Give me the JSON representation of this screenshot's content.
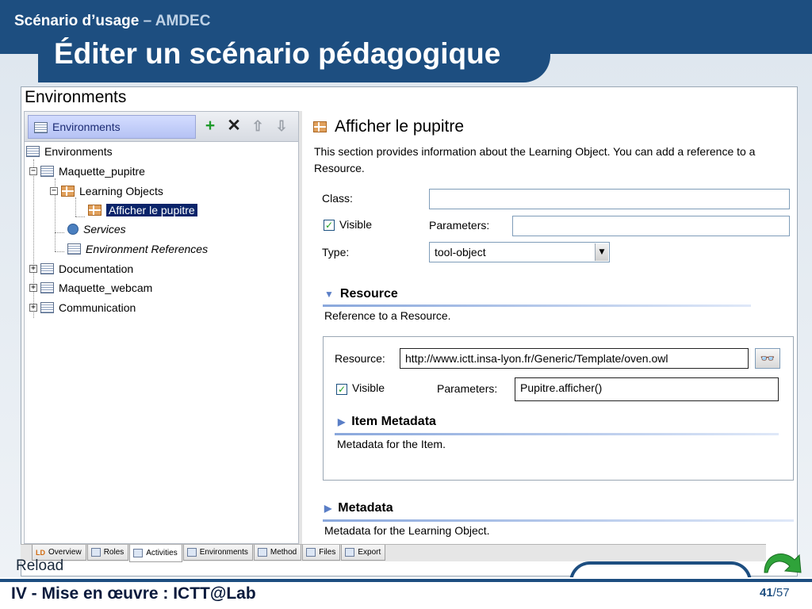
{
  "slide": {
    "subtitle_main": "Scénario d’usage",
    "subtitle_accent": "– AMDEC",
    "title": "Éditer un scénario pédagogique",
    "reload_label": "Reload",
    "footer_title": "IV - Mise en œuvre : ICTT@Lab",
    "page_current": "41",
    "page_total": "/57",
    "brand_color": "#1d4e80"
  },
  "window": {
    "title": "Environments"
  },
  "left_pane": {
    "tab_label": "Environments",
    "toolbar": {
      "add": "+",
      "delete": "✕",
      "up": "⇧",
      "down": "⇩"
    },
    "tree": {
      "root": "Environments",
      "env1": "Maquette_pupitre",
      "learning_objects": "Learning Objects",
      "selected_item": "Afficher le pupitre",
      "services": "Services",
      "env_refs": "Environment References",
      "env2": "Documentation",
      "env3": "Maquette_webcam",
      "env4": "Communication"
    }
  },
  "right_pane": {
    "title": "Afficher le pupitre",
    "description_line1": "This section provides information about the Learning Object. You can add a reference to a",
    "description_line2": "Resource.",
    "class_label": "Class:",
    "class_value": "",
    "visible_label": "Visible",
    "visible_checked": "✓",
    "parameters_label": "Parameters:",
    "parameters_value": "",
    "type_label": "Type:",
    "type_value": "tool-object",
    "resource_section": {
      "title": "Resource",
      "description": "Reference to a Resource.",
      "resource_label": "Resource:",
      "resource_value": "http://www.ictt.insa-lyon.fr/Generic/Template/oven.owl",
      "visible_label": "Visible",
      "visible_checked": "✓",
      "parameters_label": "Parameters:",
      "parameters_value": "Pupitre.afficher()",
      "item_metadata_title": "Item Metadata",
      "item_metadata_desc": "Metadata for the Item."
    },
    "metadata_section": {
      "title": "Metadata",
      "description": "Metadata for the Learning Object."
    }
  },
  "bottom_tabs": [
    {
      "label": "Overview"
    },
    {
      "label": "Roles"
    },
    {
      "label": "Activities"
    },
    {
      "label": "Environments"
    },
    {
      "label": "Method"
    },
    {
      "label": "Files"
    },
    {
      "label": "Export"
    }
  ],
  "bottom_tabs_prefix": "LD"
}
